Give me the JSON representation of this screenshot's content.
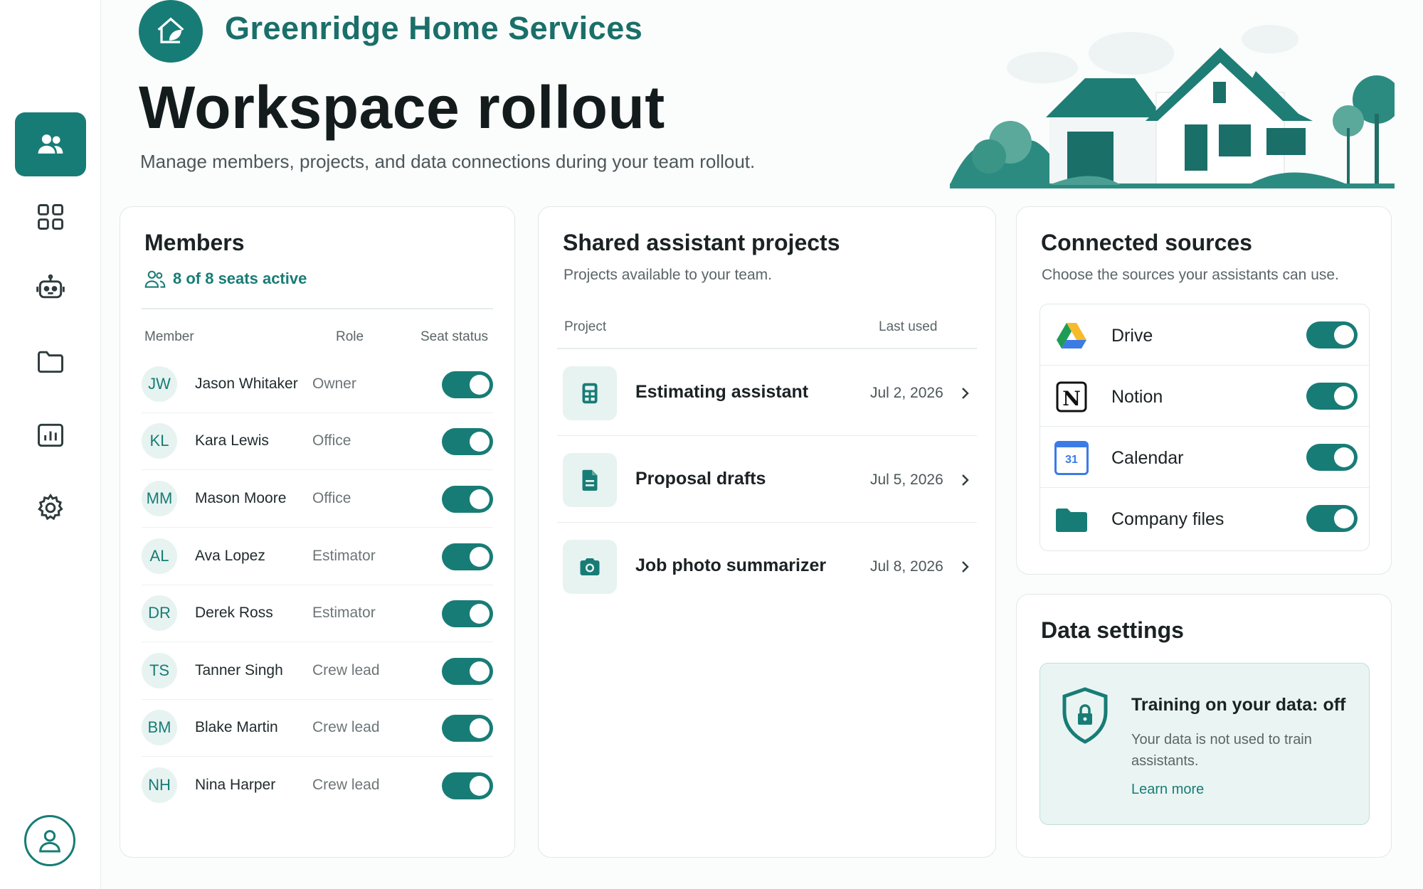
{
  "brand": {
    "name": "Greenridge Home Services"
  },
  "page": {
    "title": "Workspace rollout",
    "subtitle": "Manage members, projects, and data connections during your team rollout."
  },
  "sidebar": {
    "items": [
      {
        "icon": "users-icon",
        "active": true
      },
      {
        "icon": "grid-icon",
        "active": false
      },
      {
        "icon": "robot-icon",
        "active": false
      },
      {
        "icon": "folder-icon",
        "active": false
      },
      {
        "icon": "chart-icon",
        "active": false
      },
      {
        "icon": "gear-icon",
        "active": false
      }
    ],
    "profile_icon": "user-icon"
  },
  "members": {
    "title": "Members",
    "seats": "8 of 8 seats active",
    "columns": {
      "member": "Member",
      "role": "Role",
      "status": "Seat status"
    },
    "rows": [
      {
        "initials": "JW",
        "name": "Jason Whitaker",
        "role": "Owner",
        "active": true
      },
      {
        "initials": "KL",
        "name": "Kara Lewis",
        "role": "Office",
        "active": true
      },
      {
        "initials": "MM",
        "name": "Mason Moore",
        "role": "Office",
        "active": true
      },
      {
        "initials": "AL",
        "name": "Ava Lopez",
        "role": "Estimator",
        "active": true
      },
      {
        "initials": "DR",
        "name": "Derek Ross",
        "role": "Estimator",
        "active": true
      },
      {
        "initials": "TS",
        "name": "Tanner Singh",
        "role": "Crew lead",
        "active": true
      },
      {
        "initials": "BM",
        "name": "Blake Martin",
        "role": "Crew lead",
        "active": true
      },
      {
        "initials": "NH",
        "name": "Nina Harper",
        "role": "Crew lead",
        "active": true
      }
    ]
  },
  "projects": {
    "title": "Shared assistant projects",
    "subtitle": "Projects available to your team.",
    "columns": {
      "project": "Project",
      "last_used": "Last used"
    },
    "rows": [
      {
        "icon": "calculator-icon",
        "name": "Estimating assistant",
        "date": "Jul 2, 2026"
      },
      {
        "icon": "document-icon",
        "name": "Proposal drafts",
        "date": "Jul 5, 2026"
      },
      {
        "icon": "camera-icon",
        "name": "Job photo summarizer",
        "date": "Jul 8, 2026"
      }
    ]
  },
  "sources": {
    "title": "Connected sources",
    "subtitle": "Choose the sources your assistants can use.",
    "rows": [
      {
        "icon": "google-drive-icon",
        "name": "Drive",
        "enabled": true
      },
      {
        "icon": "notion-icon",
        "name": "Notion",
        "enabled": true
      },
      {
        "icon": "calendar-icon",
        "name": "Calendar",
        "enabled": true,
        "icon_text": "31"
      },
      {
        "icon": "folder-icon",
        "name": "Company files",
        "enabled": true
      }
    ]
  },
  "data_settings": {
    "title": "Data settings",
    "notice_title": "Training on your data: off",
    "notice_body": "Your data is not used to train assistants.",
    "link": "Learn more"
  },
  "colors": {
    "accent": "#187c76",
    "accent_light": "#e7f3f1",
    "notice_bg": "#eaf5f3"
  }
}
